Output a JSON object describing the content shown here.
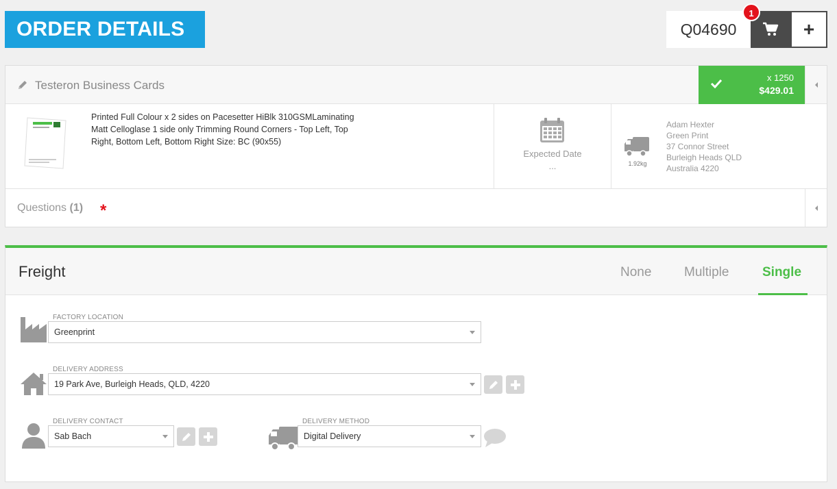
{
  "header": {
    "title": "ORDER DETAILS",
    "quote_number": "Q04690",
    "cart_count": "1",
    "add_label": "+"
  },
  "product": {
    "name": "Testeron Business Cards",
    "qty": "x 1250",
    "price": "$429.01",
    "description": "Printed Full Colour x 2 sides on Pacesetter HiBlk 310GSMLaminating Matt Celloglase 1 side only Trimming Round Corners - Top Left, Top Right, Bottom Left, Bottom Right Size: BC (90x55)",
    "expected_date_label": "Expected Date",
    "expected_date_value": "...",
    "weight": "1.92kg",
    "address": {
      "name": "Adam Hexter",
      "company": "Green Print",
      "street": "37 Connor Street",
      "city": "Burleigh Heads QLD",
      "country": "Australia 4220"
    },
    "questions_label": "Questions",
    "questions_count": "(1)",
    "required_mark": "*"
  },
  "freight": {
    "title": "Freight",
    "tabs": [
      "None",
      "Multiple",
      "Single"
    ],
    "active_tab": "Single",
    "factory_location": {
      "label": "FACTORY LOCATION",
      "value": "Greenprint"
    },
    "delivery_address": {
      "label": "DELIVERY ADDRESS",
      "value": "19 Park Ave, Burleigh Heads, QLD, 4220"
    },
    "delivery_contact": {
      "label": "DELIVERY CONTACT",
      "value": "Sab Bach"
    },
    "delivery_method": {
      "label": "DELIVERY METHOD",
      "value": "Digital Delivery"
    }
  },
  "colors": {
    "brand_blue": "#1ba1de",
    "accent_green": "#4cbe48",
    "badge_red": "#e3131c",
    "dark_button": "#4a4a4a"
  },
  "icons": [
    "pencil-icon",
    "cart-icon",
    "check-icon",
    "chevron-left-icon",
    "calendar-icon",
    "truck-icon",
    "factory-icon",
    "home-icon",
    "user-icon",
    "edit-icon",
    "add-icon",
    "comment-icon"
  ]
}
